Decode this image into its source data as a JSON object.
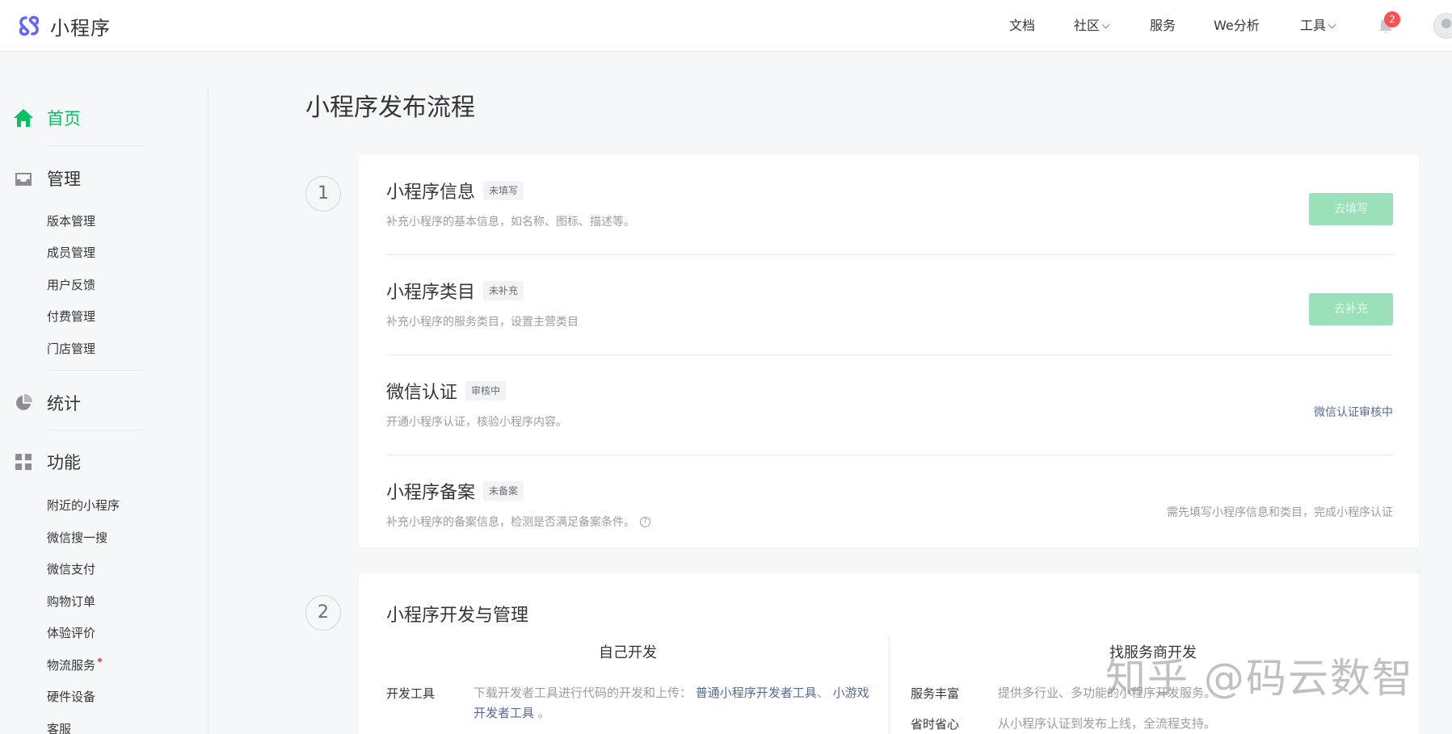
{
  "header": {
    "brand": "小程序",
    "nav": [
      {
        "label": "文档",
        "has_dropdown": false
      },
      {
        "label": "社区",
        "has_dropdown": true
      },
      {
        "label": "服务",
        "has_dropdown": false
      },
      {
        "label": "We分析",
        "has_dropdown": false
      },
      {
        "label": "工具",
        "has_dropdown": true
      }
    ],
    "notification_count": "2",
    "icons": {
      "logo": "mini-program-logo",
      "bell": "bell-icon",
      "avatar": "user-avatar"
    }
  },
  "sidebar": {
    "groups": [
      {
        "label": "首页",
        "icon": "home-icon",
        "active": true
      },
      {
        "label": "管理",
        "icon": "inbox-icon",
        "active": false,
        "items": [
          "版本管理",
          "成员管理",
          "用户反馈",
          "付费管理",
          "门店管理"
        ]
      },
      {
        "label": "统计",
        "icon": "pie-chart-icon",
        "active": false
      },
      {
        "label": "功能",
        "icon": "grid-icon",
        "active": false,
        "items": [
          "附近的小程序",
          "微信搜一搜",
          "微信支付",
          "购物订单",
          "体验评价",
          "物流服务",
          "硬件设备",
          "客服"
        ]
      }
    ],
    "accent_color": "#07c160"
  },
  "main": {
    "title": "小程序发布流程",
    "step1": {
      "number": "1",
      "rows": [
        {
          "title": "小程序信息",
          "tag": "未填写",
          "desc": "补充小程序的基本信息，如名称、图标、描述等。",
          "action": "去填写"
        },
        {
          "title": "小程序类目",
          "tag": "未补充",
          "desc": "补充小程序的服务类目，设置主营类目",
          "action": "去补充"
        },
        {
          "title": "微信认证",
          "tag": "审核中",
          "desc": "开通小程序认证，核验小程序内容。",
          "link": "微信认证审核中"
        },
        {
          "title": "小程序备案",
          "tag": "未备案",
          "desc": "补充小程序的备案信息，检测是否满足备案条件。",
          "note": "需先填写小程序信息和类目，完成小程序认证"
        }
      ]
    },
    "step2": {
      "number": "2",
      "title": "小程序开发与管理",
      "self_dev": {
        "heading": "自己开发",
        "key": "开发工具",
        "desc_prefix": "下载开发者工具进行代码的开发和上传：",
        "link1": "普通小程序开发者工具",
        "sep": "、",
        "link2": "小游戏开发者工具",
        "suffix": "。"
      },
      "provider_dev": {
        "heading": "找服务商开发",
        "items": [
          {
            "key": "服务丰富",
            "value": "提供多行业、多功能的小程序开发服务。"
          },
          {
            "key": "省时省心",
            "value": "从小程序认证到发布上线，全流程支持。"
          }
        ]
      }
    }
  },
  "watermark": "知乎 @码云数智"
}
